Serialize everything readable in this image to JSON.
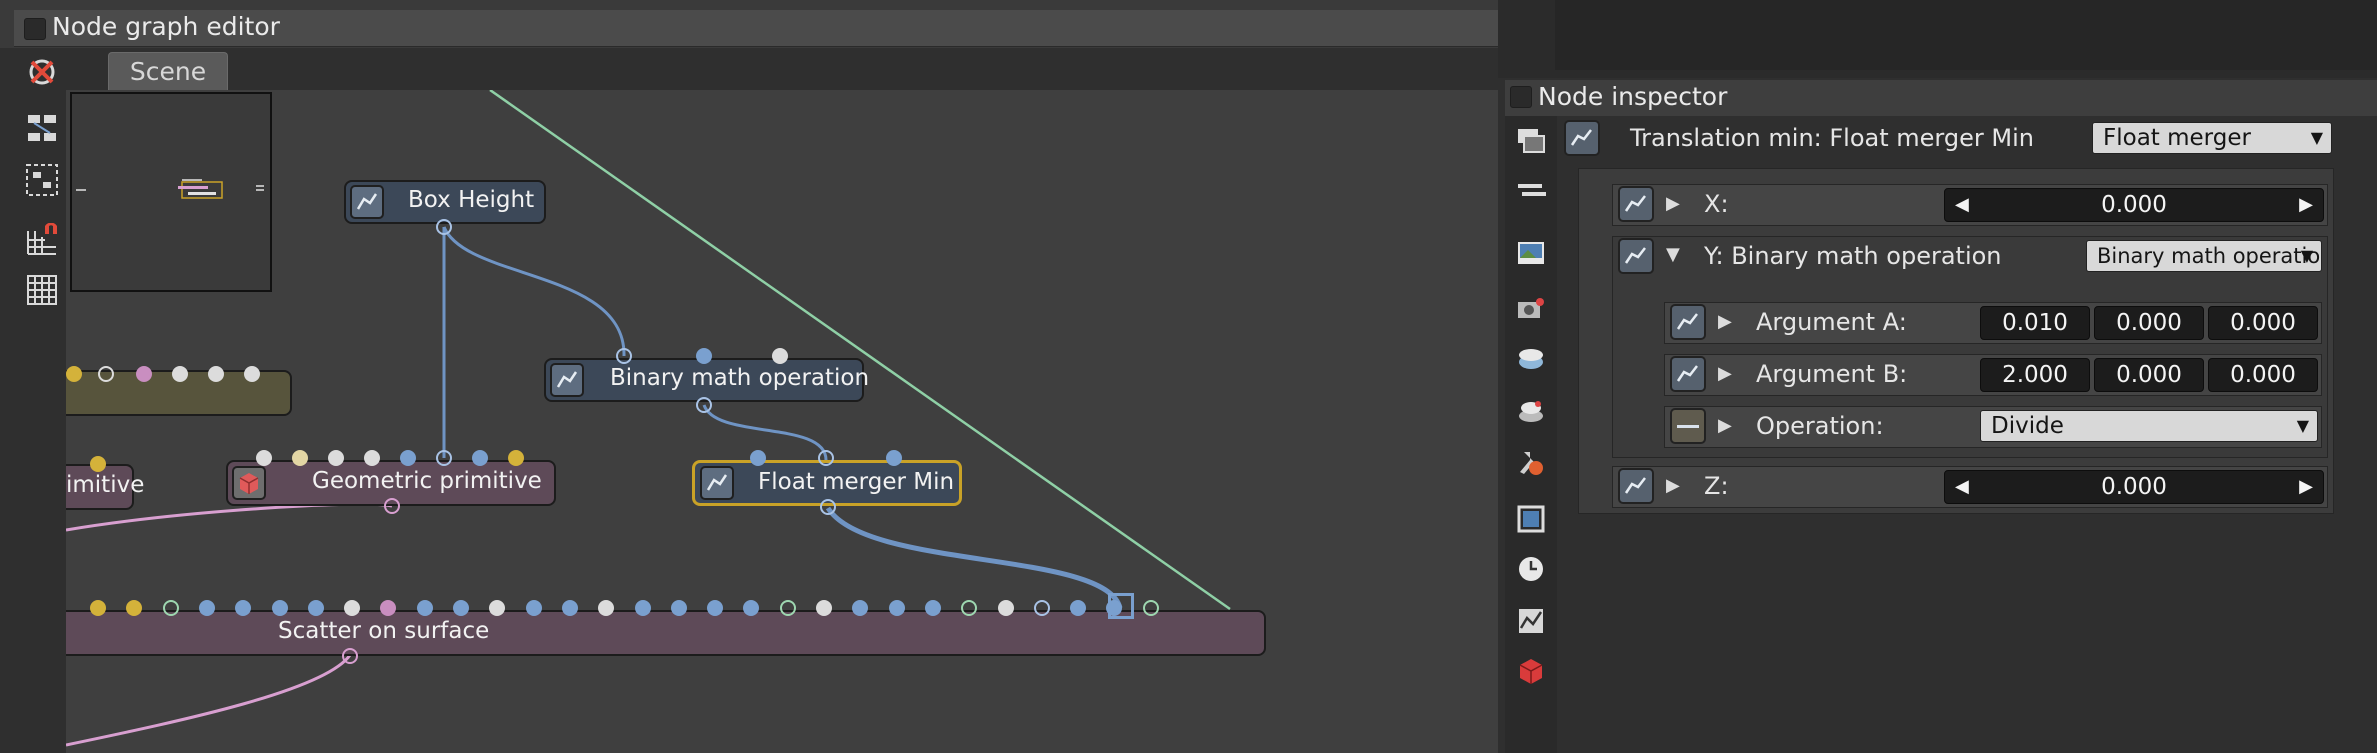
{
  "editor": {
    "title": "Node graph editor",
    "tab_label": "Scene"
  },
  "nodes": {
    "box_height": "Box Height",
    "binary_math": "Binary math operation",
    "geometric_primitive": "Geometric primitive",
    "float_merger_min": "Float merger Min",
    "scatter_on_surface": "Scatter on surface",
    "partial_primitive": "imitive"
  },
  "inspector": {
    "title": "Node inspector",
    "header_label": "Translation min: Float merger Min",
    "header_type": "Float merger",
    "x_label": "X:",
    "x_value": "0.000",
    "y_label": "Y: Binary math operation",
    "y_type": "Binary math operation",
    "arg_a_label": "Argument A:",
    "arg_a_values": [
      "0.010",
      "0.000",
      "0.000"
    ],
    "arg_b_label": "Argument B:",
    "arg_b_values": [
      "2.000",
      "0.000",
      "0.000"
    ],
    "operation_label": "Operation:",
    "operation_value": "Divide",
    "z_label": "Z:",
    "z_value": "0.000"
  },
  "colors": {
    "link_blue": "#6f94c4",
    "link_green": "#8fd0a6",
    "link_pink": "#d89fd0",
    "selected_border": "#c9a227"
  }
}
